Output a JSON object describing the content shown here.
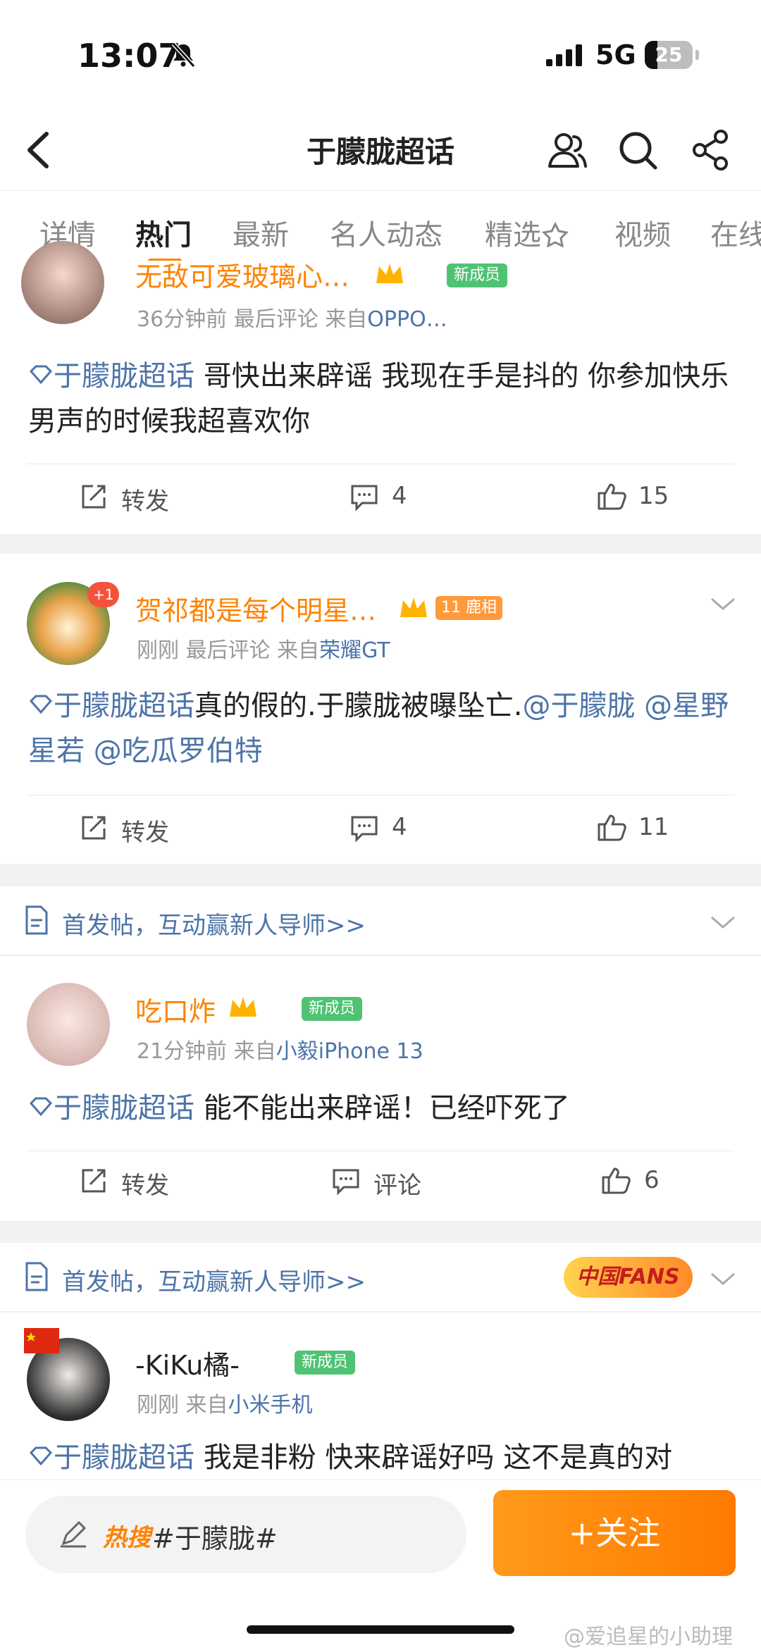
{
  "status": {
    "time": "13:07",
    "network": "5G",
    "battery": "25"
  },
  "nav": {
    "title": "于朦胧超话"
  },
  "tabs": [
    "详情",
    "热门",
    "最新",
    "名人动态",
    "精选",
    "视频",
    "在线"
  ],
  "posts": [
    {
      "username": "无敌可爱玻璃心…",
      "badge": "新成员",
      "time": "36分钟前",
      "last": "最后评论",
      "from": "来自",
      "source": "OPPO…",
      "topic": "于朦胧超话",
      "text": " 哥快出来辟谣 我现在手是抖的 你参加快乐男声的时候我超喜欢你",
      "repost": "转发",
      "comments": "4",
      "likes": "15"
    },
    {
      "username": "贺祁都是每个明星…",
      "level_badge": "鹿相",
      "level": "11",
      "notify": "+1",
      "time": "刚刚",
      "last": "最后评论",
      "from": "来自",
      "source": "荣耀GT",
      "topic": "于朦胧超话",
      "text": "真的假的.于朦胧被曝坠亡.",
      "mentions": [
        "@于朦胧",
        "@星野星若",
        "@吃瓜罗伯特"
      ],
      "repost": "转发",
      "comments": "4",
      "likes": "11"
    },
    {
      "promo": "首发帖，互动赢新人导师>>",
      "username": "吃口炸",
      "badge": "新成员",
      "time": "21分钟前",
      "from": "来自",
      "source": "小毅iPhone 13",
      "topic": "于朦胧超话",
      "text": " 能不能出来辟谣！已经吓死了",
      "repost": "转发",
      "comments": "评论",
      "likes": "6",
      "deco": "中国FANS"
    },
    {
      "promo": "首发帖，互动赢新人导师>>",
      "username": "-KiKu橘-",
      "badge": "新成员",
      "time": "刚刚",
      "from": "来自",
      "source": "小米手机",
      "topic": "于朦胧超话",
      "text": " 我是非粉 快来辟谣好吗 这不是真的对"
    }
  ],
  "bottom": {
    "hot_label": "热搜",
    "hashtag": "#于朦胧#",
    "follow": "+关注"
  },
  "watermark": "@爱追星的小助理"
}
